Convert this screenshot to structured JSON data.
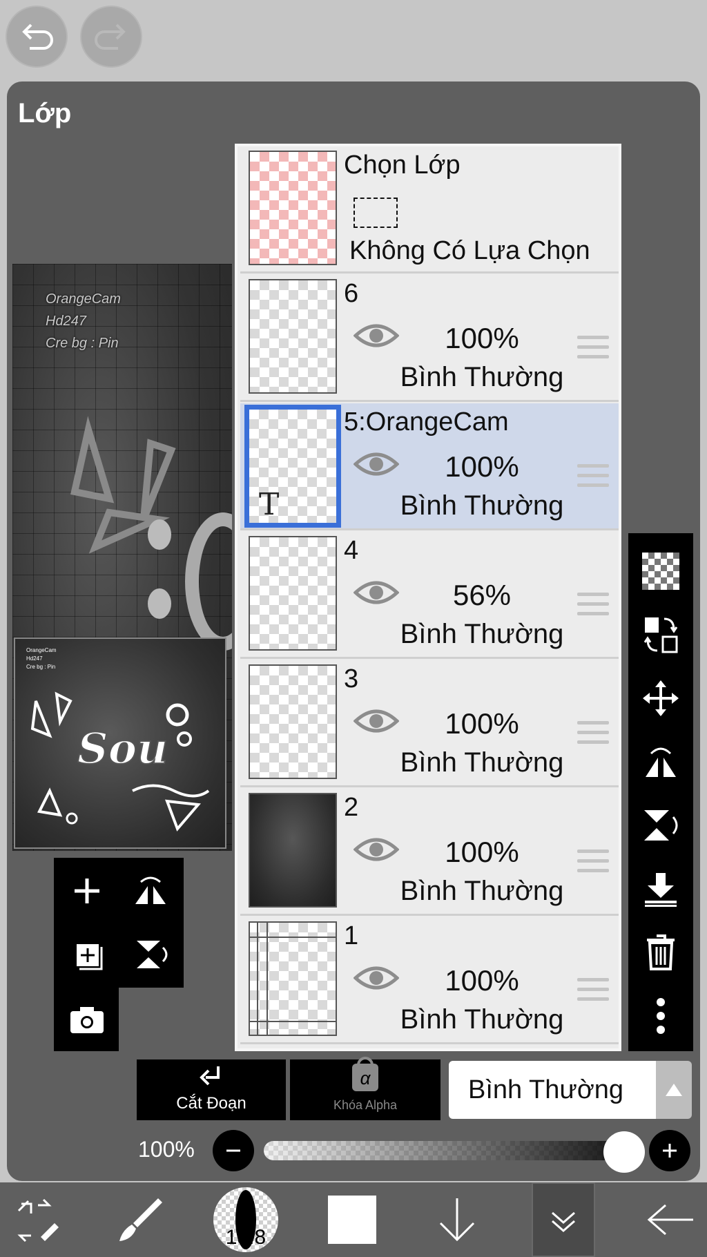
{
  "top": {
    "undo_icon": "undo-icon",
    "redo_icon": "redo-icon"
  },
  "panel": {
    "title": "Lớp"
  },
  "canvas": {
    "watermark": [
      "OrangeCam",
      "Hd247",
      "Cre bg : Pin"
    ],
    "thumb_watermark": [
      "OrangeCam",
      "Hd247",
      "Cre bg : Pin"
    ]
  },
  "selection_row": {
    "title": "Chọn Lớp",
    "status": "Không Có Lựa Chọn"
  },
  "layers": [
    {
      "name": "6",
      "opacity": "100%",
      "blend": "Bình Thường",
      "visible": true,
      "selected": false
    },
    {
      "name": "5:OrangeCam",
      "opacity": "100%",
      "blend": "Bình Thường",
      "visible": true,
      "selected": true,
      "type_glyph": "T"
    },
    {
      "name": "4",
      "opacity": "56%",
      "blend": "Bình Thường",
      "visible": true,
      "selected": false
    },
    {
      "name": "3",
      "opacity": "100%",
      "blend": "Bình Thường",
      "visible": true,
      "selected": false
    },
    {
      "name": "2",
      "opacity": "100%",
      "blend": "Bình Thường",
      "visible": true,
      "selected": false
    },
    {
      "name": "1",
      "opacity": "100%",
      "blend": "Bình Thường",
      "visible": true,
      "selected": false
    }
  ],
  "right_toolbar": [
    "transparency-icon",
    "swap-layer-icon",
    "move-icon",
    "flip-horizontal-icon",
    "flip-vertical-icon",
    "merge-down-icon",
    "trash-icon",
    "more-icon"
  ],
  "left_tools": [
    "add-layer-icon",
    "flip-h-icon",
    "add-copy-icon",
    "flip-v-icon",
    "camera-icon"
  ],
  "bottom_controls": {
    "clip_label": "Cắt Đoạn",
    "alpha_lock_label": "Khóa Alpha",
    "alpha_lock_glyph": "α",
    "blend_mode": "Bình Thường",
    "opacity_label": "100%",
    "opacity_value": 1.0
  },
  "bottom_toolbar": {
    "brush_size": "18.8",
    "icons": [
      "selection-tools-icon",
      "brush-icon",
      "brush-size-icon",
      "color-swatch-icon",
      "move-down-icon",
      "layers-icon",
      "back-icon"
    ],
    "swatch_color": "#ffffff"
  }
}
